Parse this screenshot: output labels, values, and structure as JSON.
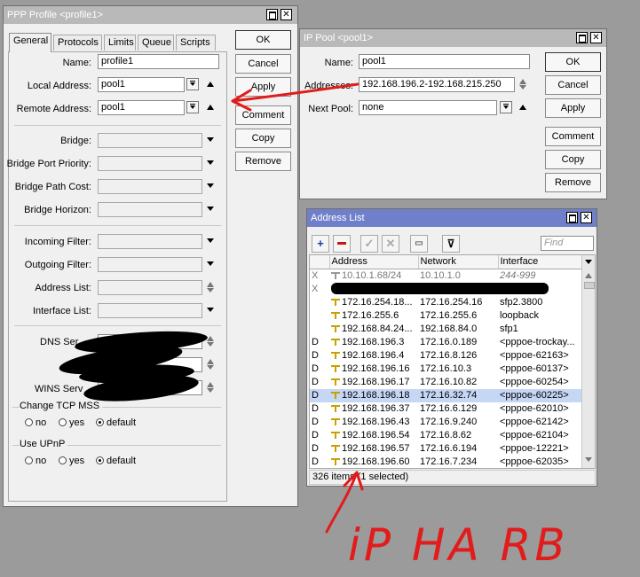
{
  "ppp_profile": {
    "title": "PPP Profile <profile1>",
    "tabs": [
      "General",
      "Protocols",
      "Limits",
      "Queue",
      "Scripts"
    ],
    "fields": {
      "name_label": "Name:",
      "name_value": "profile1",
      "local_address_label": "Local Address:",
      "local_address_value": "pool1",
      "remote_address_label": "Remote Address:",
      "remote_address_value": "pool1",
      "bridge_label": "Bridge:",
      "bridge_port_priority_label": "Bridge Port Priority:",
      "bridge_path_cost_label": "Bridge Path Cost:",
      "bridge_horizon_label": "Bridge Horizon:",
      "incoming_filter_label": "Incoming Filter:",
      "outgoing_filter_label": "Outgoing Filter:",
      "address_list_label": "Address List:",
      "interface_list_label": "Interface List:",
      "dns_server_label": "DNS Ser",
      "wins_server_label": "WINS Serv"
    },
    "change_tcp_mss": {
      "title": "Change TCP MSS",
      "options": [
        "no",
        "yes",
        "default"
      ],
      "selected": "default"
    },
    "use_upnp": {
      "title": "Use UPnP",
      "options": [
        "no",
        "yes",
        "default"
      ],
      "selected": "default"
    },
    "buttons": {
      "ok": "OK",
      "cancel": "Cancel",
      "apply": "Apply",
      "comment": "Comment",
      "copy": "Copy",
      "remove": "Remove"
    }
  },
  "ip_pool": {
    "title": "IP Pool <pool1>",
    "name_label": "Name:",
    "name_value": "pool1",
    "addresses_label": "Addresses:",
    "addresses_value": "192.168.196.2-192.168.215.250",
    "next_pool_label": "Next Pool:",
    "next_pool_value": "none",
    "buttons": {
      "ok": "OK",
      "cancel": "Cancel",
      "apply": "Apply",
      "comment": "Comment",
      "copy": "Copy",
      "remove": "Remove"
    }
  },
  "address_list": {
    "title": "Address List",
    "find_placeholder": "Find",
    "columns": [
      "Address",
      "Network",
      "Interface"
    ],
    "rows": [
      {
        "flag": "X",
        "address": "10.10.1.68/24",
        "network": "10.10.1.0",
        "interface": "244-999",
        "disabled": true
      },
      {
        "flag": "X",
        "address": "",
        "network": "",
        "interface": "",
        "disabled": true
      },
      {
        "flag": "",
        "address": "172.16.254.18...",
        "network": "172.16.254.16",
        "interface": "sfp2.3800"
      },
      {
        "flag": "",
        "address": "172.16.255.6",
        "network": "172.16.255.6",
        "interface": "loopback"
      },
      {
        "flag": "",
        "address": "192.168.84.24...",
        "network": "192.168.84.0",
        "interface": "sfp1"
      },
      {
        "flag": "D",
        "address": "192.168.196.3",
        "network": "172.16.0.189",
        "interface": "<pppoe-trockay..."
      },
      {
        "flag": "D",
        "address": "192.168.196.4",
        "network": "172.16.8.126",
        "interface": "<pppoe-62163>"
      },
      {
        "flag": "D",
        "address": "192.168.196.16",
        "network": "172.16.10.3",
        "interface": "<pppoe-60137>"
      },
      {
        "flag": "D",
        "address": "192.168.196.17",
        "network": "172.16.10.82",
        "interface": "<pppoe-60254>"
      },
      {
        "flag": "D",
        "address": "192.168.196.18",
        "network": "172.16.32.74",
        "interface": "<pppoe-60225>",
        "selected": true
      },
      {
        "flag": "D",
        "address": "192.168.196.37",
        "network": "172.16.6.129",
        "interface": "<pppoe-62010>"
      },
      {
        "flag": "D",
        "address": "192.168.196.43",
        "network": "172.16.9.240",
        "interface": "<pppoe-62142>"
      },
      {
        "flag": "D",
        "address": "192.168.196.54",
        "network": "172.16.8.62",
        "interface": "<pppoe-62104>"
      },
      {
        "flag": "D",
        "address": "192.168.196.57",
        "network": "172.16.6.194",
        "interface": "<pppoe-12221>"
      },
      {
        "flag": "D",
        "address": "192.168.196.60",
        "network": "172.16.7.234",
        "interface": "<pppoe-62035>"
      }
    ],
    "status": "326 items (1 selected)"
  },
  "annotation": {
    "text": "iP HA RB",
    "color": "#e21b1b"
  }
}
